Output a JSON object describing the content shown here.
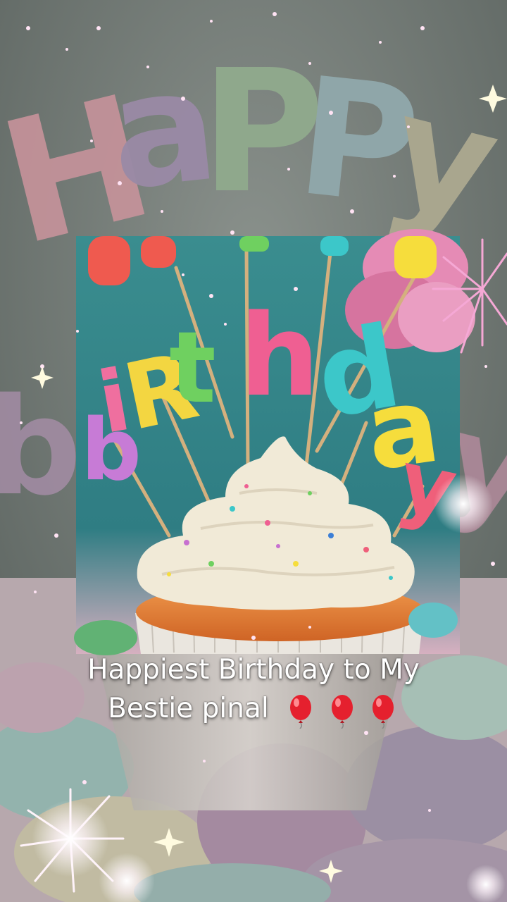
{
  "image": {
    "description_icons": [
      "birthday-cupcake",
      "balloon-icon",
      "sparkle"
    ],
    "colors": {
      "background": "#6f7873",
      "frame_bg": "#3f8f90",
      "frosting": "#f1ead7",
      "cupcake": "#e47a36",
      "sparkle": "#ffd3ee"
    }
  },
  "background_word": [
    "H",
    "A",
    "P",
    "P",
    "Y"
  ],
  "frame_word": [
    "b",
    "i",
    "r",
    "t",
    "h",
    "d",
    "a",
    "y"
  ],
  "caption": {
    "line1": "Happiest Birthday to My",
    "line2": "Bestie pinal",
    "emojis": [
      "balloon-icon",
      "balloon-icon",
      "balloon-icon"
    ]
  }
}
